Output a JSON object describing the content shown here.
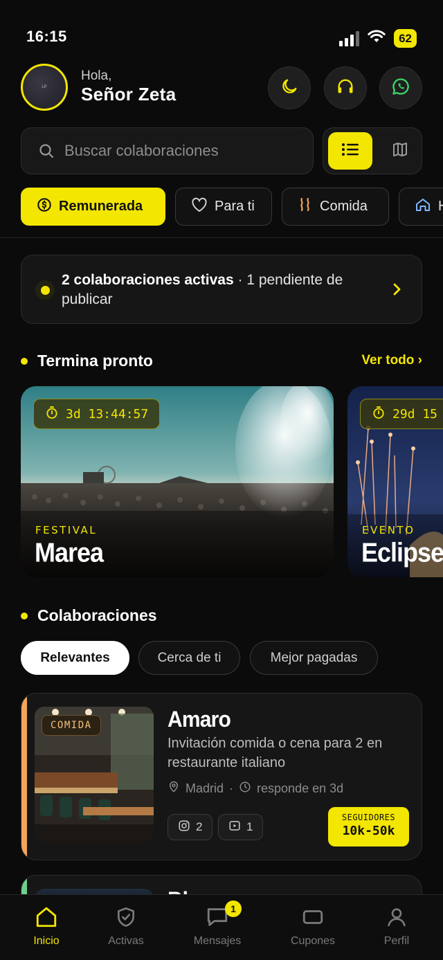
{
  "status": {
    "time": "16:15",
    "battery": "62"
  },
  "header": {
    "greeting": "Hola,",
    "user_name": "Señor Zeta",
    "avatar_initials": "LP"
  },
  "search": {
    "placeholder": "Buscar colaboraciones"
  },
  "categories": [
    {
      "label": "Remunerada",
      "icon": "coin-icon",
      "active": true
    },
    {
      "label": "Para ti",
      "icon": "heart-icon",
      "active": false
    },
    {
      "label": "Comida",
      "icon": "steam-icon",
      "active": false
    },
    {
      "label": "H",
      "icon": "home-icon",
      "active": false
    }
  ],
  "banner": {
    "bold": "2 colaboraciones activas",
    "rest": " · 1 pendiente de publicar"
  },
  "ending_soon": {
    "title": "Termina pronto",
    "see_all": "Ver todo ›",
    "events": [
      {
        "timer": "3d 13:44:57",
        "category": "FESTIVAL",
        "name": "Marea"
      },
      {
        "timer": "29d 15",
        "category": "EVENTO",
        "name": "Eclipse"
      }
    ]
  },
  "collaborations": {
    "title": "Colaboraciones",
    "filters": [
      {
        "label": "Relevantes",
        "active": true
      },
      {
        "label": "Cerca de ti",
        "active": false
      },
      {
        "label": "Mejor pagadas",
        "active": false
      }
    ],
    "items": [
      {
        "tag": "COMIDA",
        "title": "Amaro",
        "description": "Invitación comida o cena para 2 en restaurante italiano",
        "location": "Madrid",
        "response": "responde en 3d",
        "instagram_count": "2",
        "video_count": "1",
        "followers_label": "SEGUIDORES",
        "followers_range": "10k-50k",
        "accent": "#f2a65a"
      },
      {
        "title": "Bloque",
        "accent": "#6fcf8a"
      }
    ]
  },
  "nav": [
    {
      "label": "Inicio",
      "icon": "home-icon",
      "active": true
    },
    {
      "label": "Activas",
      "icon": "shield-check-icon",
      "active": false
    },
    {
      "label": "Mensajes",
      "icon": "message-icon",
      "active": false,
      "badge": "1"
    },
    {
      "label": "Cupones",
      "icon": "coupon-icon",
      "active": false
    },
    {
      "label": "Perfil",
      "icon": "user-icon",
      "active": false
    }
  ],
  "colors": {
    "accent": "#f3e600",
    "background": "#0b0b0b",
    "card": "#161616"
  }
}
